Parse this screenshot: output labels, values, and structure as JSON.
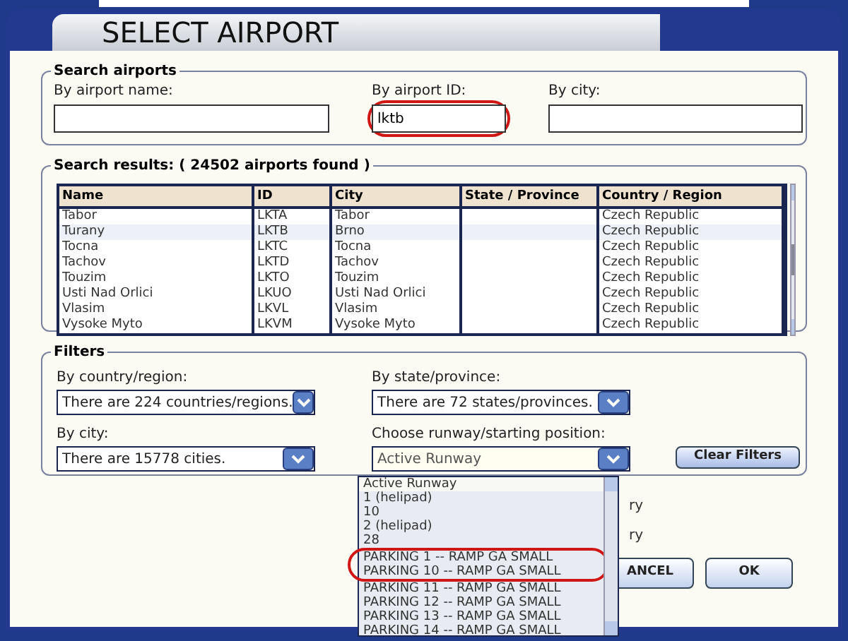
{
  "window": {
    "title": "SELECT AIRPORT"
  },
  "search": {
    "legend": "Search airports",
    "fields": [
      {
        "label": "By airport name:",
        "circled": false
      },
      {
        "label": "By airport ID:",
        "value": "lktb",
        "circled": true
      },
      {
        "label": "By city:",
        "circled": false
      }
    ]
  },
  "results": {
    "legend": "Search results: ( 24502 airports found )",
    "columns": [
      "Name",
      "ID",
      "City",
      "State / Province",
      "Country / Region"
    ],
    "rows": [
      {
        "cells": [
          "Tabor",
          "LKTA",
          "Tabor",
          "",
          "Czech Republic"
        ],
        "selected": false
      },
      {
        "cells": [
          "Turany",
          "LKTB",
          "Brno",
          "",
          "Czech Republic"
        ],
        "selected": true
      },
      {
        "cells": [
          "Tocna",
          "LKTC",
          "Tocna",
          "",
          "Czech Republic"
        ],
        "selected": false
      },
      {
        "cells": [
          "Tachov",
          "LKTD",
          "Tachov",
          "",
          "Czech Republic"
        ],
        "selected": false
      },
      {
        "cells": [
          "Touzim",
          "LKTO",
          "Touzim",
          "",
          "Czech Republic"
        ],
        "selected": false
      },
      {
        "cells": [
          "Usti Nad Orlici",
          "LKUO",
          "Usti Nad Orlici",
          "",
          "Czech Republic"
        ],
        "selected": false
      },
      {
        "cells": [
          "Vlasim",
          "LKVL",
          "Vlasim",
          "",
          "Czech Republic"
        ],
        "selected": false
      },
      {
        "cells": [
          "Vysoke Myto",
          "LKVM",
          "Vysoke Myto",
          "",
          "Czech Republic"
        ],
        "selected": false
      }
    ]
  },
  "filters": {
    "legend": "Filters",
    "dropdowns": [
      {
        "label": "By country/region:",
        "value": "There are 224 countries/regions.",
        "expanded": false
      },
      {
        "label": "By state/province:",
        "value": "There are 72 states/provinces.",
        "expanded": false
      },
      {
        "label": "By city:",
        "value": "There are 15778 cities.",
        "expanded": false
      },
      {
        "label": "Choose runway/starting position:",
        "value": "Active Runway",
        "expanded": true
      }
    ],
    "clear_button": "Clear Filters",
    "hidden_labels": [
      "ry",
      "ry"
    ]
  },
  "runway_list": [
    {
      "label": "Active Runway",
      "selected": true,
      "circled": false
    },
    {
      "label": "1 (helipad)",
      "selected": false,
      "circled": false
    },
    {
      "label": "10",
      "selected": false,
      "circled": false
    },
    {
      "label": "2 (helipad)",
      "selected": false,
      "circled": false
    },
    {
      "label": "28",
      "selected": false,
      "circled": false
    },
    {
      "label": "PARKING 1 -- RAMP GA SMALL",
      "selected": false,
      "circled": true
    },
    {
      "label": "PARKING 10 -- RAMP GA SMALL",
      "selected": false,
      "circled": true
    },
    {
      "label": "PARKING 11 -- RAMP GA SMALL",
      "selected": false,
      "circled": false
    },
    {
      "label": "PARKING 12 -- RAMP GA SMALL",
      "selected": false,
      "circled": false
    },
    {
      "label": "PARKING 13 -- RAMP GA SMALL",
      "selected": false,
      "circled": false
    },
    {
      "label": "PARKING 14 -- RAMP GA SMALL",
      "selected": false,
      "circled": false
    }
  ],
  "buttons": [
    "ANCEL",
    "OK"
  ]
}
